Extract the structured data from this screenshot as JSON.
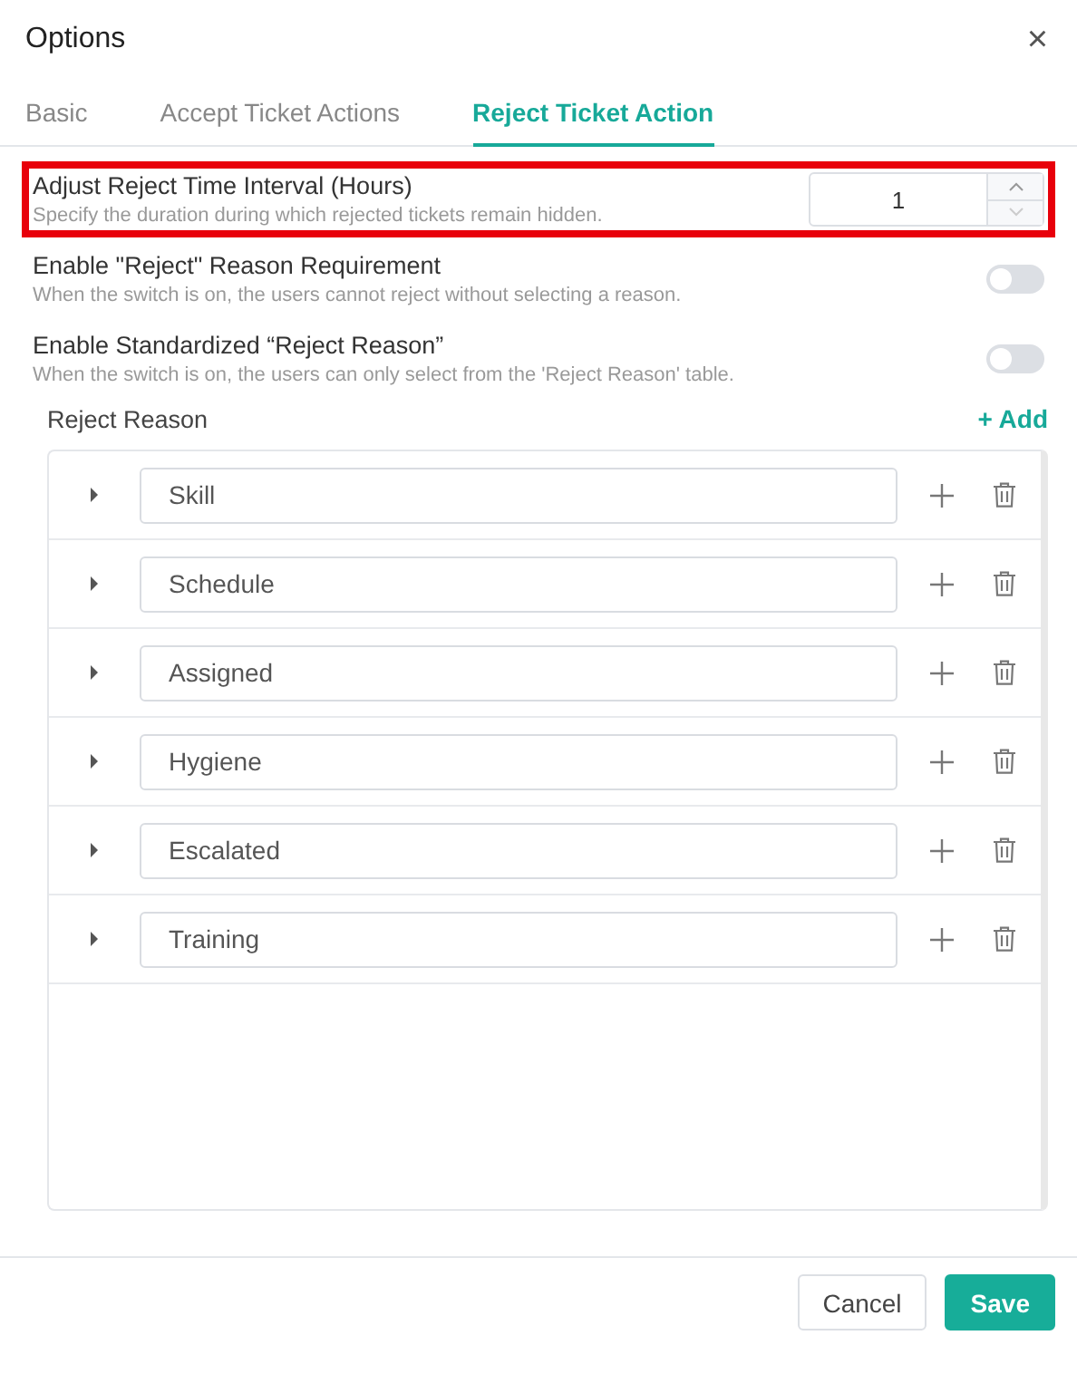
{
  "window": {
    "title": "Options",
    "close": "×"
  },
  "tabs": [
    {
      "label": "Basic",
      "selected": false
    },
    {
      "label": "Accept Ticket Actions",
      "selected": false
    },
    {
      "label": "Reject Ticket Action",
      "selected": true
    }
  ],
  "settings": [
    {
      "kind": "number",
      "title": "Adjust Reject Time Interval (Hours)",
      "description": "Specify the duration during which rejected tickets remain hidden.",
      "value": "1",
      "highlighted": true
    },
    {
      "kind": "switch",
      "title": "Enable \"Reject\" Reason Requirement",
      "description": "When the switch is on, the users cannot reject without selecting a reason.",
      "on": false,
      "highlighted": false
    },
    {
      "kind": "switch",
      "title": "Enable Standardized “Reject Reason”",
      "description": "When the switch is on, the users can only select from the 'Reject Reason' table.",
      "on": false,
      "highlighted": false
    }
  ],
  "reasons": {
    "title": "Reject Reason",
    "add": "+ Add",
    "rows": [
      {
        "name": "Skill",
        "expanded": false
      },
      {
        "name": "Schedule",
        "expanded": false
      },
      {
        "name": "Assigned",
        "expanded": false
      },
      {
        "name": "Hygiene",
        "expanded": false
      },
      {
        "name": "Escalated",
        "expanded": false
      },
      {
        "name": "Training",
        "expanded": false
      }
    ]
  },
  "buttons": [
    {
      "label": "Cancel",
      "kind": "secondary"
    },
    {
      "label": "Save",
      "kind": "primary"
    }
  ]
}
